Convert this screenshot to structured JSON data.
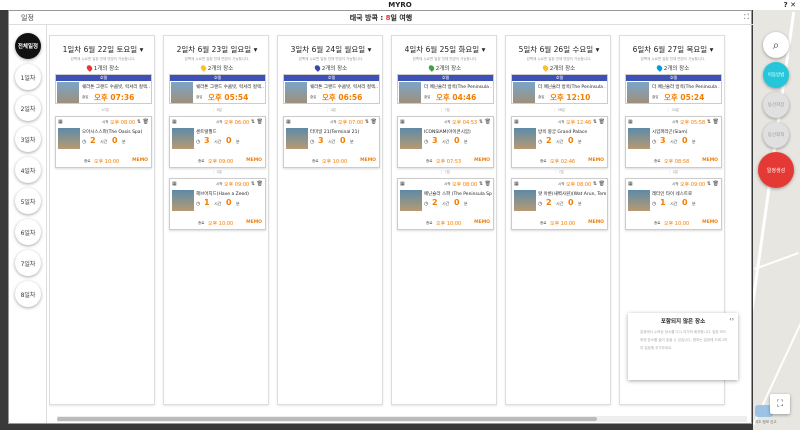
{
  "app": {
    "title": "MYRO",
    "window_icons": "? ✕"
  },
  "header": {
    "left_label": "일정",
    "trip_title_prefix": "태국 방콕 : ",
    "trip_title_days": "8",
    "trip_title_suffix": "일 여행",
    "expand_icon": "⛶"
  },
  "sidebar": {
    "items": [
      "전체일정",
      "1일차",
      "2일차",
      "3일차",
      "4일차",
      "5일차",
      "6일차",
      "7일차",
      "8일차"
    ]
  },
  "days": [
    {
      "title": "1일차 6월 22일 토요일",
      "subtitle": "왼쪽에 누르면 일정 전체 변경이 가능합니다.",
      "places": "1개의 장소",
      "pin_color": "#e53935",
      "hotel": {
        "label": "호텔",
        "name": "쉐라톤 그랜드 수쿰빗, 럭셔리 컬렉...",
        "time_label": "출발",
        "time": "오후 07:36"
      },
      "activities": [
        {
          "gap": "47분",
          "start_label": "시작",
          "start": "오후 08:00",
          "name": "오아시스스파(The Oasis Spa)",
          "hours": "2",
          "hours_label": "시간",
          "minutes": "0",
          "minutes_label": "분",
          "end_label": "종료",
          "end": "오후 10:00",
          "memo": "MEMO"
        }
      ]
    },
    {
      "title": "2일차 6월 23일 일요일",
      "subtitle": "왼쪽에 누르면 일정 전체 변경이 가능합니다.",
      "places": "2개의 장소",
      "pin_color": "#fbc02d",
      "hotel": {
        "label": "호텔",
        "name": "쉐라톤 그랜드 수쿰빗, 럭셔리 컬렉...",
        "time_label": "출발",
        "time": "오후 05:54"
      },
      "activities": [
        {
          "gap": "6분",
          "start_label": "시작",
          "start": "오후 06:00",
          "name": "센트럴월드",
          "hours": "3",
          "hours_label": "시간",
          "minutes": "0",
          "minutes_label": "분",
          "end_label": "종료",
          "end": "오후 09:00",
          "memo": "MEMO"
        },
        {
          "gap": "0분",
          "start_label": "시작",
          "start": "오후 09:00",
          "name": "헤브어지드(Have a Zeed)",
          "hours": "1",
          "hours_label": "시간",
          "minutes": "0",
          "minutes_label": "분",
          "end_label": "종료",
          "end": "오후 10:00",
          "memo": "MEMO"
        }
      ]
    },
    {
      "title": "3일차 6월 24일 월요일",
      "subtitle": "왼쪽에 누르면 일정 전체 변경이 가능합니다.",
      "places": "2개의 장소",
      "pin_color": "#3949ab",
      "hotel": {
        "label": "호텔",
        "name": "쉐라톤 그랜드 수쿰빗, 럭셔리 컬렉...",
        "time_label": "출발",
        "time": "오후 06:56"
      },
      "activities": [
        {
          "gap": "4분",
          "start_label": "시작",
          "start": "오후 07:00",
          "name": "터미널 21(Terminal 21)",
          "hours": "3",
          "hours_label": "시간",
          "minutes": "0",
          "minutes_label": "분",
          "end_label": "종료",
          "end": "오후 10:00",
          "memo": "MEMO"
        }
      ]
    },
    {
      "title": "4일차 6월 25일 화요일",
      "subtitle": "왼쪽에 누르면 일정 전체 변경이 가능합니다.",
      "places": "2개의 장소",
      "pin_color": "#43a047",
      "hotel": {
        "label": "호텔",
        "name": "더 페닌슐라 방콕(The Peninsula ...",
        "time_label": "출발",
        "time": "오후 04:46"
      },
      "activities": [
        {
          "gap": "7분",
          "start_label": "시작",
          "start": "오후 04:53",
          "name": "ICONSIAM(아이콘시암)",
          "hours": "3",
          "hours_label": "시간",
          "minutes": "0",
          "minutes_label": "분",
          "end_label": "종료",
          "end": "오후 07:53",
          "memo": "MEMO"
        },
        {
          "gap": "7분",
          "start_label": "시작",
          "start": "오후 08:00",
          "name": "페닌슐라 스파 (The Peninsula Spa)",
          "hours": "2",
          "hours_label": "시간",
          "minutes": "0",
          "minutes_label": "분",
          "end_label": "종료",
          "end": "오후 10:00",
          "memo": "MEMO"
        }
      ]
    },
    {
      "title": "5일차 6월 26일 수요일",
      "subtitle": "왼쪽에 누르면 일정 전체 변경이 가능합니다.",
      "places": "2개의 장소",
      "pin_color": "#fbc02d",
      "hotel": {
        "label": "호텔",
        "name": "더 페닌슐라 방콕(The Peninsula ...",
        "time_label": "출발",
        "time": "오후 12:10"
      },
      "activities": [
        {
          "gap": "36분",
          "start_label": "시작",
          "start": "오후 12:46",
          "name": "방콕 왕궁 Grand Palace",
          "hours": "2",
          "hours_label": "시간",
          "minutes": "0",
          "minutes_label": "분",
          "end_label": "종료",
          "end": "오후 02:46",
          "memo": "MEMO"
        },
        {
          "gap": "7분",
          "start_label": "시작",
          "start": "오후 08:00",
          "name": "왓 아룬(새벽사원)(Wat Arun, Tem...",
          "hours": "2",
          "hours_label": "시간",
          "minutes": "0",
          "minutes_label": "분",
          "end_label": "종료",
          "end": "오후 10:00",
          "memo": "MEMO"
        }
      ]
    },
    {
      "title": "6일차 6월 27일 목요일",
      "subtitle": "왼쪽에 누르면 일정 전체 변경이 가능합니다.",
      "places": "2개의 장소",
      "pin_color": "#039be5",
      "hotel": {
        "label": "호텔",
        "name": "더 페닌슐라 방콕(The Peninsula ...",
        "time_label": "출발",
        "time": "오후 05:24"
      },
      "activities": [
        {
          "gap": "34분",
          "start_label": "시작",
          "start": "오후 05:58",
          "name": "시암파라곤(Siam)",
          "hours": "3",
          "hours_label": "시간",
          "minutes": "0",
          "minutes_label": "분",
          "end_label": "종료",
          "end": "오후 08:58",
          "memo": "MEMO"
        },
        {
          "gap": "2분",
          "start_label": "시작",
          "start": "오후 09:00",
          "name": "레터인 타이 네스트로",
          "hours": "1",
          "hours_label": "시간",
          "minutes": "0",
          "minutes_label": "분",
          "end_label": "종료",
          "end": "오후 10:00",
          "memo": "MEMO"
        }
      ]
    }
  ],
  "unincluded_panel": {
    "title": "포함되지 않은 장소",
    "arrows": "‹›",
    "text": "일정에서 누락된 장소를 다시 여기에 배치합니다. 일정 보드 위에 장소를 끌어 놓을 수 있습니다. 원하는 일정에 드래그하여 일정에 추가하세요."
  },
  "map_panel": {
    "search_icon": "⌕",
    "btn_add": "이동방법",
    "btn_a": "동선저장",
    "btn_b": "동선최적",
    "btn_save": "일정생성",
    "fullscreen_icon": "⛶",
    "footer": "지도 정보 신고"
  }
}
